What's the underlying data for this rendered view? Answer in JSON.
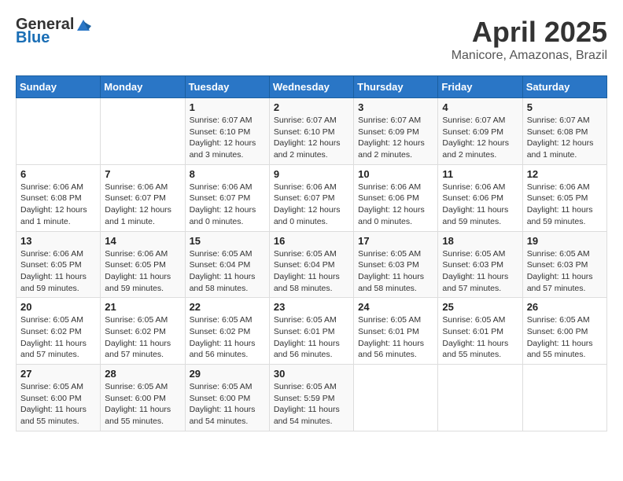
{
  "logo": {
    "text_general": "General",
    "text_blue": "Blue"
  },
  "header": {
    "month": "April 2025",
    "location": "Manicore, Amazonas, Brazil"
  },
  "weekdays": [
    "Sunday",
    "Monday",
    "Tuesday",
    "Wednesday",
    "Thursday",
    "Friday",
    "Saturday"
  ],
  "weeks": [
    [
      {
        "day": "",
        "info": ""
      },
      {
        "day": "",
        "info": ""
      },
      {
        "day": "1",
        "info": "Sunrise: 6:07 AM\nSunset: 6:10 PM\nDaylight: 12 hours\nand 3 minutes."
      },
      {
        "day": "2",
        "info": "Sunrise: 6:07 AM\nSunset: 6:10 PM\nDaylight: 12 hours\nand 2 minutes."
      },
      {
        "day": "3",
        "info": "Sunrise: 6:07 AM\nSunset: 6:09 PM\nDaylight: 12 hours\nand 2 minutes."
      },
      {
        "day": "4",
        "info": "Sunrise: 6:07 AM\nSunset: 6:09 PM\nDaylight: 12 hours\nand 2 minutes."
      },
      {
        "day": "5",
        "info": "Sunrise: 6:07 AM\nSunset: 6:08 PM\nDaylight: 12 hours\nand 1 minute."
      }
    ],
    [
      {
        "day": "6",
        "info": "Sunrise: 6:06 AM\nSunset: 6:08 PM\nDaylight: 12 hours\nand 1 minute."
      },
      {
        "day": "7",
        "info": "Sunrise: 6:06 AM\nSunset: 6:07 PM\nDaylight: 12 hours\nand 1 minute."
      },
      {
        "day": "8",
        "info": "Sunrise: 6:06 AM\nSunset: 6:07 PM\nDaylight: 12 hours\nand 0 minutes."
      },
      {
        "day": "9",
        "info": "Sunrise: 6:06 AM\nSunset: 6:07 PM\nDaylight: 12 hours\nand 0 minutes."
      },
      {
        "day": "10",
        "info": "Sunrise: 6:06 AM\nSunset: 6:06 PM\nDaylight: 12 hours\nand 0 minutes."
      },
      {
        "day": "11",
        "info": "Sunrise: 6:06 AM\nSunset: 6:06 PM\nDaylight: 11 hours\nand 59 minutes."
      },
      {
        "day": "12",
        "info": "Sunrise: 6:06 AM\nSunset: 6:05 PM\nDaylight: 11 hours\nand 59 minutes."
      }
    ],
    [
      {
        "day": "13",
        "info": "Sunrise: 6:06 AM\nSunset: 6:05 PM\nDaylight: 11 hours\nand 59 minutes."
      },
      {
        "day": "14",
        "info": "Sunrise: 6:06 AM\nSunset: 6:05 PM\nDaylight: 11 hours\nand 59 minutes."
      },
      {
        "day": "15",
        "info": "Sunrise: 6:05 AM\nSunset: 6:04 PM\nDaylight: 11 hours\nand 58 minutes."
      },
      {
        "day": "16",
        "info": "Sunrise: 6:05 AM\nSunset: 6:04 PM\nDaylight: 11 hours\nand 58 minutes."
      },
      {
        "day": "17",
        "info": "Sunrise: 6:05 AM\nSunset: 6:03 PM\nDaylight: 11 hours\nand 58 minutes."
      },
      {
        "day": "18",
        "info": "Sunrise: 6:05 AM\nSunset: 6:03 PM\nDaylight: 11 hours\nand 57 minutes."
      },
      {
        "day": "19",
        "info": "Sunrise: 6:05 AM\nSunset: 6:03 PM\nDaylight: 11 hours\nand 57 minutes."
      }
    ],
    [
      {
        "day": "20",
        "info": "Sunrise: 6:05 AM\nSunset: 6:02 PM\nDaylight: 11 hours\nand 57 minutes."
      },
      {
        "day": "21",
        "info": "Sunrise: 6:05 AM\nSunset: 6:02 PM\nDaylight: 11 hours\nand 57 minutes."
      },
      {
        "day": "22",
        "info": "Sunrise: 6:05 AM\nSunset: 6:02 PM\nDaylight: 11 hours\nand 56 minutes."
      },
      {
        "day": "23",
        "info": "Sunrise: 6:05 AM\nSunset: 6:01 PM\nDaylight: 11 hours\nand 56 minutes."
      },
      {
        "day": "24",
        "info": "Sunrise: 6:05 AM\nSunset: 6:01 PM\nDaylight: 11 hours\nand 56 minutes."
      },
      {
        "day": "25",
        "info": "Sunrise: 6:05 AM\nSunset: 6:01 PM\nDaylight: 11 hours\nand 55 minutes."
      },
      {
        "day": "26",
        "info": "Sunrise: 6:05 AM\nSunset: 6:00 PM\nDaylight: 11 hours\nand 55 minutes."
      }
    ],
    [
      {
        "day": "27",
        "info": "Sunrise: 6:05 AM\nSunset: 6:00 PM\nDaylight: 11 hours\nand 55 minutes."
      },
      {
        "day": "28",
        "info": "Sunrise: 6:05 AM\nSunset: 6:00 PM\nDaylight: 11 hours\nand 55 minutes."
      },
      {
        "day": "29",
        "info": "Sunrise: 6:05 AM\nSunset: 6:00 PM\nDaylight: 11 hours\nand 54 minutes."
      },
      {
        "day": "30",
        "info": "Sunrise: 6:05 AM\nSunset: 5:59 PM\nDaylight: 11 hours\nand 54 minutes."
      },
      {
        "day": "",
        "info": ""
      },
      {
        "day": "",
        "info": ""
      },
      {
        "day": "",
        "info": ""
      }
    ]
  ]
}
